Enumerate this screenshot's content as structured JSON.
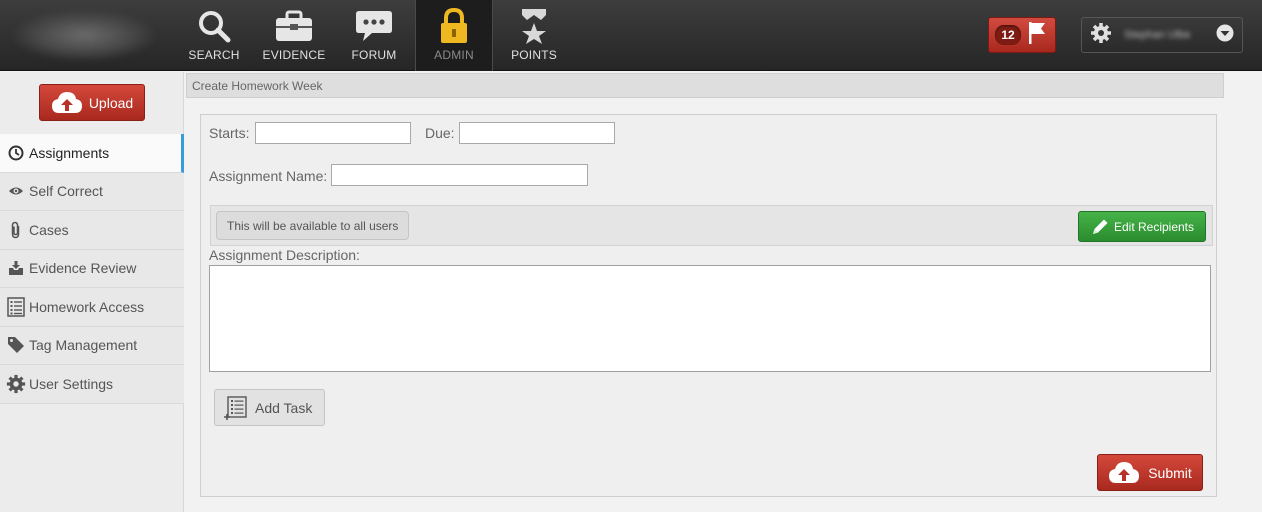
{
  "header": {
    "nav": [
      {
        "label": "SEARCH",
        "icon": "search-icon"
      },
      {
        "label": "EVIDENCE",
        "icon": "briefcase-icon"
      },
      {
        "label": "FORUM",
        "icon": "chat-bubble-icon"
      },
      {
        "label": "ADMIN",
        "icon": "lock-icon",
        "active": true
      },
      {
        "label": "POINTS",
        "icon": "points-star-icon"
      }
    ],
    "notifications_count": "12",
    "user_name": "Stephan Ulbe"
  },
  "sidebar": {
    "upload_label": "Upload",
    "items": [
      {
        "label": "Assignments",
        "icon": "clock-icon",
        "active": true
      },
      {
        "label": "Self Correct",
        "icon": "eye-icon"
      },
      {
        "label": "Cases",
        "icon": "paperclip-icon"
      },
      {
        "label": "Evidence Review",
        "icon": "inbox-download-icon"
      },
      {
        "label": "Homework Access",
        "icon": "list-icon"
      },
      {
        "label": "Tag Management",
        "icon": "tag-icon"
      },
      {
        "label": "User Settings",
        "icon": "gear-icon"
      }
    ]
  },
  "main": {
    "breadcrumb": "Create Homework Week",
    "form": {
      "starts_label": "Starts:",
      "starts_value": "",
      "due_label": "Due:",
      "due_value": "",
      "assignment_name_label": "Assignment Name:",
      "assignment_name_value": "",
      "availability_text": "This will be available to all users",
      "edit_recipients_label": "Edit Recipients",
      "description_label": "Assignment Description:",
      "description_value": "",
      "add_task_label": "Add Task",
      "submit_label": "Submit"
    }
  },
  "colors": {
    "red_button": "#c0392b",
    "green_button": "#34a038",
    "active_indicator": "#3a9bd9",
    "topbar": "#2e2e2e"
  }
}
